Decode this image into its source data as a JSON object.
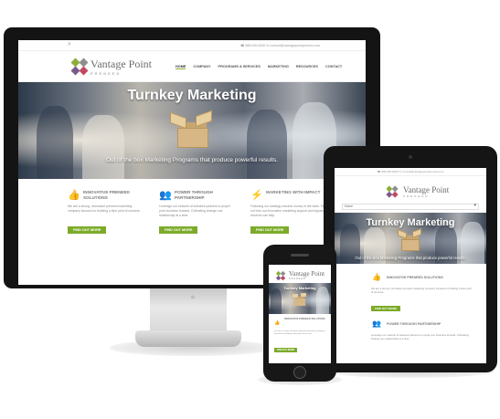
{
  "site": {
    "topbar": {
      "contact": "☎ 888.000.0000   ✉ consult@vantagepointprened.com",
      "tablet_contact": "☎ 888.000.0000   ✉ consult@vantagepointprened.com"
    },
    "logo": {
      "name": "Vantage Point",
      "tagline": "PRENEED"
    },
    "nav": [
      "HOME",
      "COMPANY",
      "PROGRAMS & SERVICES",
      "MARKETING",
      "RESOURCES",
      "CONTACT"
    ],
    "nav_active": "HOME",
    "mobile_select": "Home",
    "hero": {
      "title": "Turnkey Marketing",
      "tagline": "Out of the box Marketing Programs that produce powerful results."
    },
    "features": [
      {
        "icon": "thumbs-up-icon",
        "title": "INNOVATIVE PRENEED SOLUTIONS",
        "body": "We are a strong, innovative preneed marketing company focused on building a blue print of success.",
        "button": "FIND OUT MORE"
      },
      {
        "icon": "group-icon",
        "title": "POWER THROUGH PARTNERSHIP",
        "body": "Leverage our network of selected partners to propel your business forward. Cultivating change one relationship at a time.",
        "button": "FIND OUT MORE"
      },
      {
        "icon": "lightning-icon",
        "title": "MARKETING WITH IMPACT",
        "body": "Following our strategy ensures money in the bank. Find out how our innovative marketing support and signature services can help.",
        "button": "FIND OUT MORE"
      }
    ]
  },
  "colors": {
    "accent_green": "#7cab2a",
    "device_black": "#151515",
    "logo_gray": "#6b6b6b"
  }
}
